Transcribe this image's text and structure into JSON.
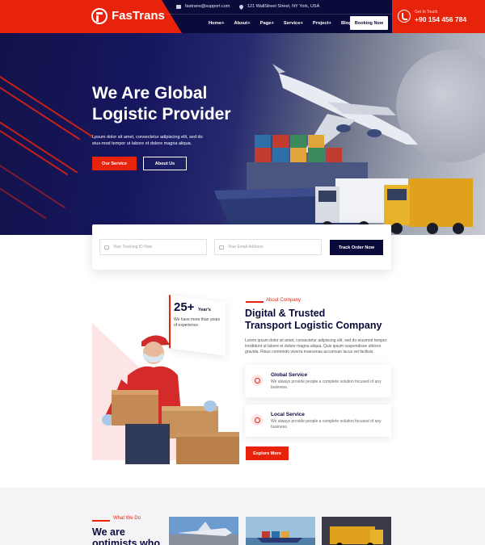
{
  "header": {
    "brand": "FasTrans",
    "email": "fastrans@support.com",
    "address": "121 WallStreet Street, NY York, USA",
    "nav": [
      "Home+",
      "About+",
      "Page+",
      "Service+",
      "Project+",
      "Blog+"
    ],
    "booking_label": "Booking Now",
    "contact_label": "Get In Touch",
    "phone": "+90 154 456 784",
    "colors": {
      "brand_red": "#e8230c",
      "navy": "#0b0b3b"
    }
  },
  "hero": {
    "title_line1": "We Are Global",
    "title_line2": "Logistic Provider",
    "description": "Lpsum dolor sit amet, consectetur adipiscing elit, sed do eius-mod tempor ut labore et dolore magna aliqua.",
    "primary_button": "Our Service",
    "secondary_button": "About Us"
  },
  "track": {
    "tracking_placeholder": "Your Tracking ID Now",
    "email_placeholder": "Your Email Address",
    "button": "Track Order Now"
  },
  "about": {
    "years_number": "25+",
    "years_label": "Year's",
    "years_desc": "We have more than years of experience",
    "section_label": "About Company",
    "title_line1": "Digital & Trusted",
    "title_line2": "Transport Logistic Company",
    "description": "Lorem ipsum dolor sit amet, consectetur adipiscing elit, sed do eiusmod tempor incididunt ut labore et dolore magna aliqua. Quis ipsum suspendisse ultrices gravida. Risus commodo viverra maecenas accumsan lacus vel facilisis.",
    "services": [
      {
        "title": "Global Service",
        "desc": "We always provide people a complete solution focused of any business."
      },
      {
        "title": "Local Service",
        "desc": "We always provide people a complete solution focused of any business."
      }
    ],
    "explore_button": "Explore More"
  },
  "what": {
    "section_label": "What We Do",
    "title_line1": "We are",
    "title_line2": "optimists who"
  }
}
